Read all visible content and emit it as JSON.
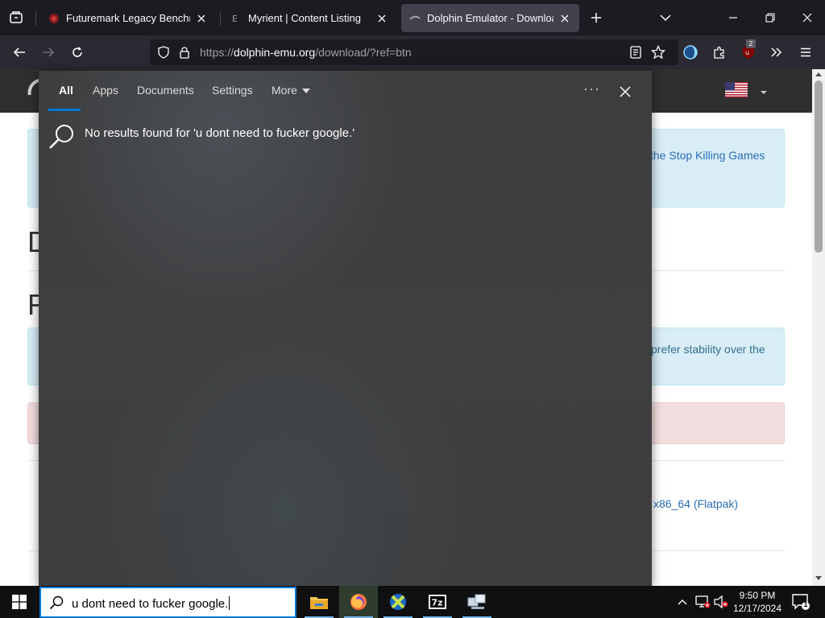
{
  "browser": {
    "tabs": [
      {
        "title": "Futuremark Legacy Benchmark",
        "active": false
      },
      {
        "title": "Myrient | Content Listing",
        "active": false
      },
      {
        "title": "Dolphin Emulator - Download",
        "active": true
      }
    ],
    "url": {
      "prefix": "https://",
      "domain": "dolphin-emu.org",
      "path": "/download/?ref=btn"
    },
    "extension_badge": "2"
  },
  "webpage": {
    "alert_info_1_text": "the Stop Killing Games",
    "heading_1_fragment": "D",
    "heading_2_fragment": "F",
    "alert_info_2_text": "prefer stability over the",
    "download_link_text": "x86_64 (Flatpak)"
  },
  "search_panel": {
    "tabs": [
      {
        "label": "All",
        "active": true
      },
      {
        "label": "Apps",
        "active": false
      },
      {
        "label": "Documents",
        "active": false
      },
      {
        "label": "Settings",
        "active": false
      },
      {
        "label": "More",
        "active": false
      }
    ],
    "no_results_text": "No results found for 'u dont need to fucker google.'"
  },
  "taskbar": {
    "search_query": "u dont need to fucker google.",
    "apps": [
      "File Explorer",
      "Firefox",
      "Xenia",
      "7-Zip",
      "Network"
    ],
    "clock_time": "9:50 PM",
    "clock_date": "12/17/2024",
    "notification_count": "1"
  },
  "colors": {
    "accent": "#0078d7",
    "browser_bg": "#1c1b22",
    "toolbar_bg": "#2b2a33",
    "alert_info_bg": "#d9edf7",
    "alert_danger_bg": "#f2dede",
    "link": "#2a6eb6"
  }
}
